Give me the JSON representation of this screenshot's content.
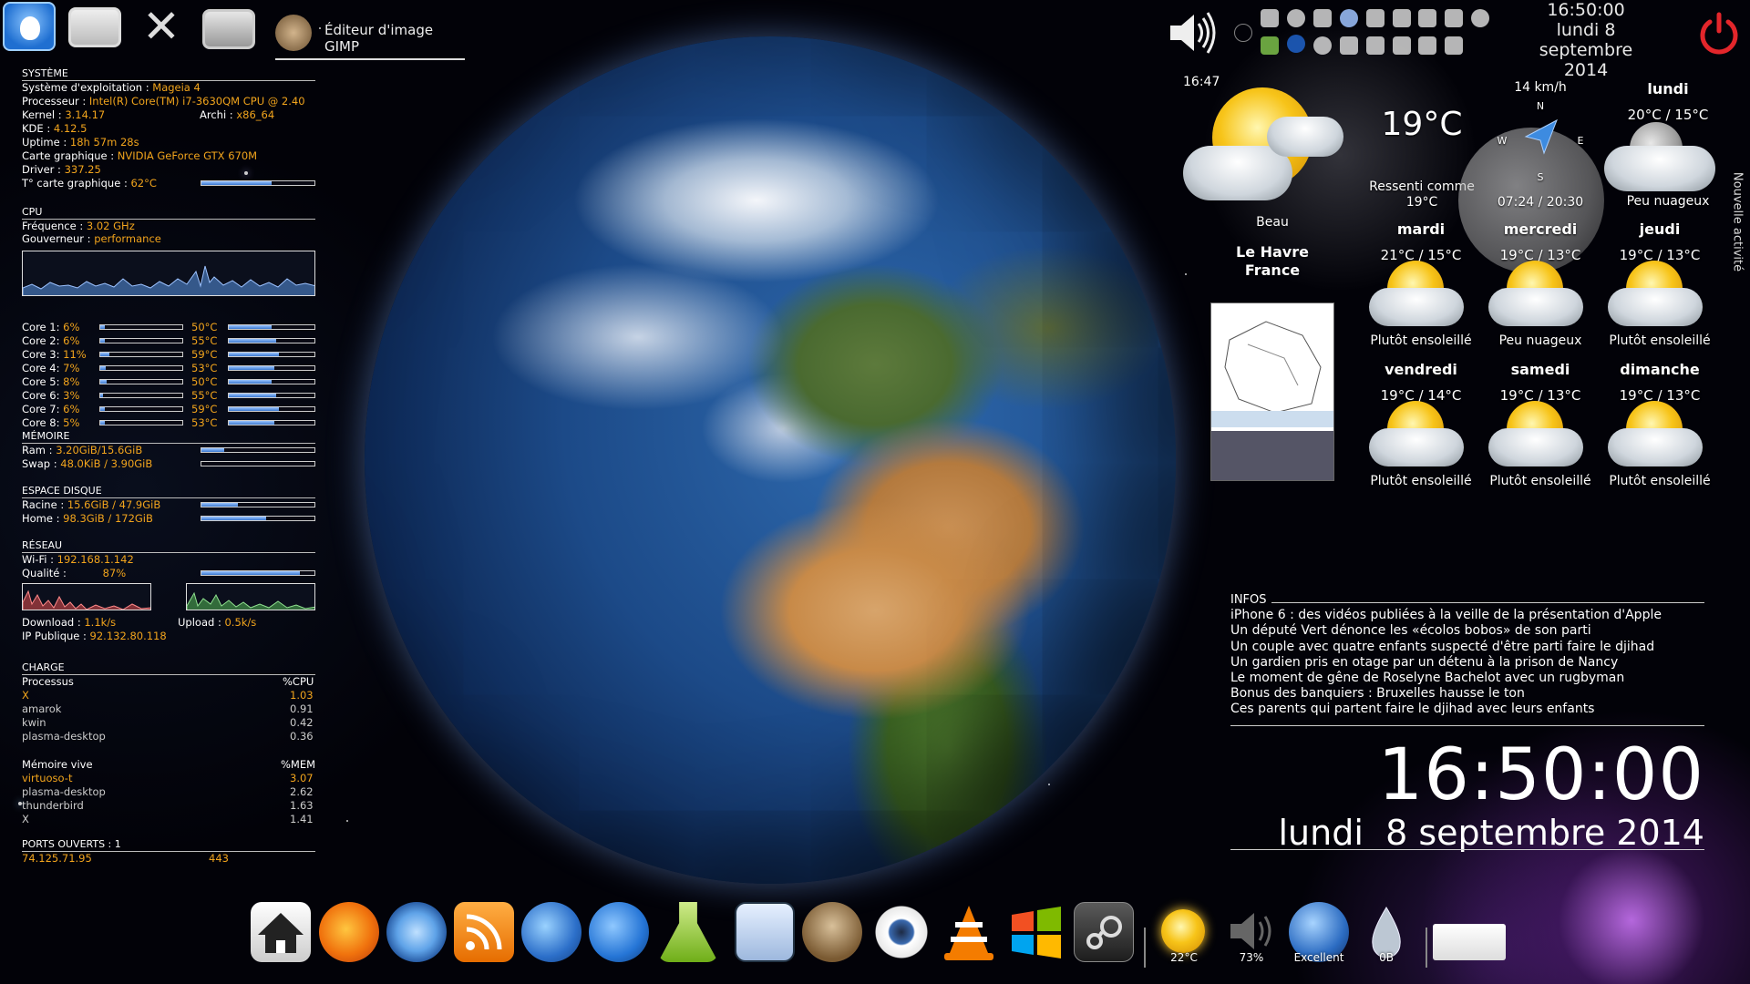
{
  "taskbar": {
    "gimp_task_label": "Éditeur d'image GIMP"
  },
  "clock_top": {
    "time": "16:50:00",
    "date_line1": "lundi 8 septembre",
    "date_line2": "2014"
  },
  "system": {
    "header": "SYSTÈME",
    "os_label": "Système d'exploitation :",
    "os_value": "Mageia 4",
    "cpu_label": "Processeur :",
    "cpu_value": "Intel(R) Core(TM) i7-3630QM CPU @ 2.40",
    "kernel_label": "Kernel :",
    "kernel_value": "3.14.17",
    "arch_label": "Archi :",
    "arch_value": "x86_64",
    "kde_label": "KDE :",
    "kde_value": "4.12.5",
    "uptime_label": "Uptime :",
    "uptime_value": "18h 57m 28s",
    "gpu_label": "Carte graphique :",
    "gpu_value": "NVIDIA GeForce GTX 670M",
    "driver_label": "Driver :",
    "driver_value": "337.25",
    "gputemp_label": "T° carte graphique :",
    "gputemp_value": "62°C",
    "gputemp_fill": 0.62
  },
  "cpu": {
    "header": "CPU",
    "freq_label": "Fréquence :",
    "freq_value": "3.02 GHz",
    "gov_label": "Gouverneur :",
    "gov_value": "performance",
    "cores": [
      {
        "label": "Core 1:",
        "usage": "6%",
        "temp": "50°C",
        "load": 0.06,
        "temp_fill": 0.5
      },
      {
        "label": "Core 2:",
        "usage": "6%",
        "temp": "55°C",
        "load": 0.06,
        "temp_fill": 0.55
      },
      {
        "label": "Core 3:",
        "usage": "11%",
        "temp": "59°C",
        "load": 0.11,
        "temp_fill": 0.59
      },
      {
        "label": "Core 4:",
        "usage": "7%",
        "temp": "53°C",
        "load": 0.07,
        "temp_fill": 0.53
      },
      {
        "label": "Core 5:",
        "usage": "8%",
        "temp": "50°C",
        "load": 0.08,
        "temp_fill": 0.5
      },
      {
        "label": "Core 6:",
        "usage": "3%",
        "temp": "55°C",
        "load": 0.03,
        "temp_fill": 0.55
      },
      {
        "label": "Core 7:",
        "usage": "6%",
        "temp": "59°C",
        "load": 0.06,
        "temp_fill": 0.59
      },
      {
        "label": "Core 8:",
        "usage": "5%",
        "temp": "53°C",
        "load": 0.05,
        "temp_fill": 0.53
      }
    ]
  },
  "memory": {
    "header": "MÉMOIRE",
    "ram_label": "Ram :",
    "ram_value": "3.20GiB/15.6GiB",
    "ram_fill": 0.205,
    "swap_label": "Swap :",
    "swap_value": "48.0KiB / 3.90GiB",
    "swap_fill": 0.0
  },
  "disk": {
    "header": "ESPACE DISQUE",
    "root_label": "Racine :",
    "root_value": "15.6GiB / 47.9GiB",
    "root_fill": 0.326,
    "home_label": "Home :",
    "home_value": "98.3GiB / 172GiB",
    "home_fill": 0.571
  },
  "network": {
    "header": "RÉSEAU",
    "wifi_label": "Wi-Fi :",
    "wifi_value": "192.168.1.142",
    "quality_label": "Qualité :",
    "quality_value": "87%",
    "quality_fill": 0.87,
    "download_label": "Download :",
    "download_value": "1.1k/s",
    "upload_label": "Upload :",
    "upload_value": "0.5k/s",
    "ip_label": "IP Publique :",
    "ip_value": "92.132.80.118"
  },
  "load": {
    "header": "CHARGE",
    "proc_header": "Processus",
    "cpu_header": "%CPU",
    "cpu_procs": [
      {
        "name": "X",
        "value": "1.03"
      },
      {
        "name": "amarok",
        "value": "0.91"
      },
      {
        "name": "kwin",
        "value": "0.42"
      },
      {
        "name": "plasma-desktop",
        "value": "0.36"
      }
    ],
    "mem_header": "Mémoire vive",
    "mem_col_header": "%MEM",
    "mem_procs": [
      {
        "name": "virtuoso-t",
        "value": "3.07"
      },
      {
        "name": "plasma-desktop",
        "value": "2.62"
      },
      {
        "name": "thunderbird",
        "value": "1.63"
      },
      {
        "name": "X",
        "value": "1.41"
      }
    ]
  },
  "ports": {
    "header": "PORTS OUVERTS : 1",
    "ip": "74.125.71.95",
    "port": "443"
  },
  "weather": {
    "time": "16:47",
    "current_temp": "19°C",
    "feels_label": "Ressenti comme",
    "feels_value": "19°C",
    "current_condition": "Beau",
    "city": "Le Havre",
    "country": "France",
    "wind": "14 km/h",
    "compass": {
      "n": "N",
      "e": "E",
      "s": "S",
      "w": "W"
    },
    "sun_times": "07:24 / 20:30",
    "today_name": "lundi",
    "today_temps": "20°C / 15°C",
    "today_condition": "Peu nuageux",
    "days": [
      {
        "name": "mardi",
        "temps": "21°C / 15°C",
        "condition": "Plutôt ensoleillé"
      },
      {
        "name": "mercredi",
        "temps": "19°C / 13°C",
        "condition": "Peu nuageux"
      },
      {
        "name": "jeudi",
        "temps": "19°C / 13°C",
        "condition": "Plutôt ensoleillé"
      },
      {
        "name": "vendredi",
        "temps": "19°C / 14°C",
        "condition": "Plutôt ensoleillé"
      },
      {
        "name": "samedi",
        "temps": "19°C / 13°C",
        "condition": "Plutôt ensoleillé"
      },
      {
        "name": "dimanche",
        "temps": "19°C / 13°C",
        "condition": "Plutôt ensoleillé"
      }
    ]
  },
  "activity_label": "Nouvelle activité",
  "news": {
    "header": "INFOS",
    "items": [
      "iPhone 6 : des vidéos publiées à la veille de la présentation d'Apple",
      "Un député Vert dénonce les «écolos bobos» de son parti",
      "Un couple avec quatre enfants suspecté d'être parti faire le djihad",
      "Un gardien pris en otage par un détenu à la prison de Nancy",
      "Le moment de gêne de Roselyne Bachelot avec un rugbyman",
      "Bonus des banquiers : Bruxelles hausse le ton",
      "Ces parents qui partent faire le djihad avec leurs enfants"
    ]
  },
  "big_clock": {
    "time": "16:50:00",
    "date": "lundi  8 septembre 2014"
  },
  "dock": {
    "weather_temp": "22°C",
    "volume": "73%",
    "network": "Excellent",
    "disk": "0B"
  }
}
